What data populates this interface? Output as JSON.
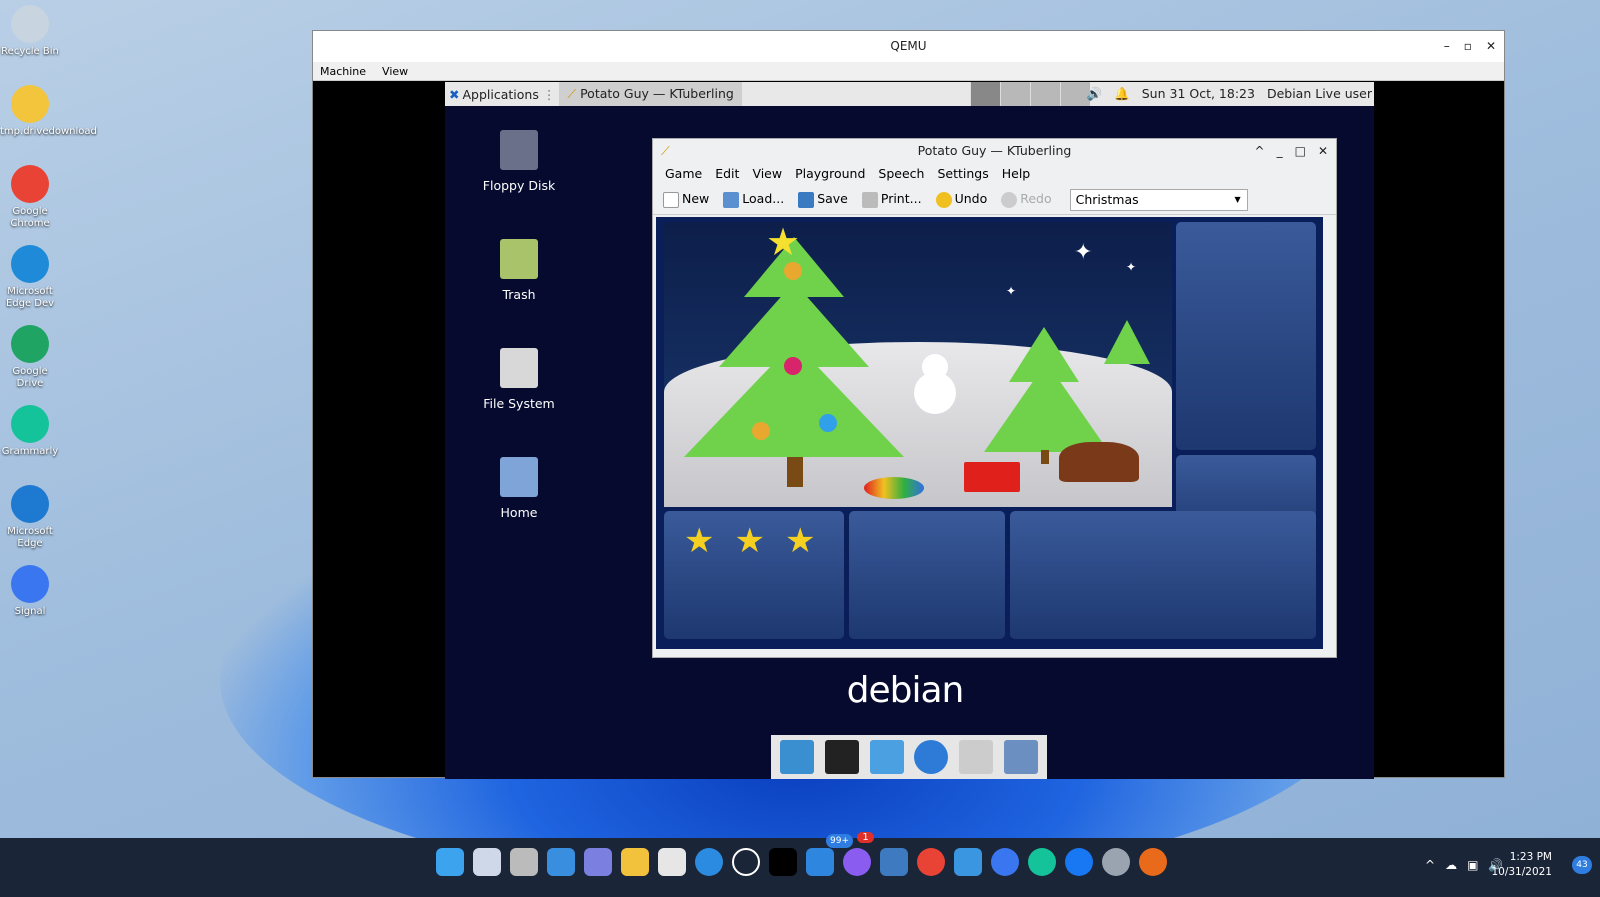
{
  "desktop": {
    "icons": [
      {
        "label": "Recycle Bin",
        "color": "#c8d4e0"
      },
      {
        "label": "tmp.drivedownload",
        "color": "#f2c53d"
      },
      {
        "label": "Google Chrome",
        "color": "#e84335"
      },
      {
        "label": "Microsoft Edge Dev",
        "color": "#1f8ad8"
      },
      {
        "label": "Google Drive",
        "color": "#1fa463"
      },
      {
        "label": "Grammarly",
        "color": "#15c39a"
      },
      {
        "label": "Microsoft Edge",
        "color": "#1e7ad0"
      },
      {
        "label": "Signal",
        "color": "#3a76f0"
      }
    ]
  },
  "qemu": {
    "title": "QEMU",
    "menu": [
      "Machine",
      "View"
    ],
    "controls": [
      "–",
      "▫",
      "✕"
    ]
  },
  "guest": {
    "panel": {
      "applications": "Applications",
      "task": "Potato Guy — KTuberling",
      "datetime": "Sun 31 Oct, 18:23",
      "user": "Debian Live user",
      "volume_icon": "🔊",
      "bell_icon": "🔔"
    },
    "icons": [
      {
        "label": "Floppy Disk",
        "color": "#6a6f8a"
      },
      {
        "label": "Trash",
        "color": "#a8c36a"
      },
      {
        "label": "File System",
        "color": "#d8d8d8"
      },
      {
        "label": "Home",
        "color": "#7fa4d8"
      }
    ],
    "logo": "debian",
    "dock": [
      {
        "name": "desktop",
        "color": "#3a8fd0"
      },
      {
        "name": "terminal",
        "color": "#222"
      },
      {
        "name": "files",
        "color": "#4aa0e0"
      },
      {
        "name": "browser",
        "color": "#2d7bd6"
      },
      {
        "name": "search",
        "color": "#ccc"
      },
      {
        "name": "folder",
        "color": "#6a8fc0"
      }
    ]
  },
  "ktuberling": {
    "title": "Potato Guy — KTuberling",
    "menu": [
      "Game",
      "Edit",
      "View",
      "Playground",
      "Speech",
      "Settings",
      "Help"
    ],
    "toolbar": {
      "new": "New",
      "load": "Load...",
      "save": "Save",
      "print": "Print...",
      "undo": "Undo",
      "redo": "Redo"
    },
    "playground": "Christmas"
  },
  "taskbar": {
    "icons": [
      {
        "name": "start",
        "color": "#3ca3ef"
      },
      {
        "name": "search",
        "color": "#cfd8e8"
      },
      {
        "name": "task-view",
        "color": "#bbbbbb"
      },
      {
        "name": "widgets",
        "color": "#3a8ee0"
      },
      {
        "name": "teams-chat",
        "color": "#7b7fe0"
      },
      {
        "name": "file-explorer",
        "color": "#f3c23d"
      },
      {
        "name": "store",
        "color": "#e6e6e6"
      },
      {
        "name": "edge-dev",
        "color": "#2a8be0"
      },
      {
        "name": "dell",
        "color": "#1b2538"
      },
      {
        "name": "terminal",
        "color": "#000000"
      },
      {
        "name": "mail",
        "color": "#2e86de"
      },
      {
        "name": "messenger",
        "color": "#8a5cf0"
      },
      {
        "name": "remote-desktop",
        "color": "#3d7ac0"
      },
      {
        "name": "chrome",
        "color": "#e84335"
      },
      {
        "name": "people",
        "color": "#3a96e0"
      },
      {
        "name": "signal",
        "color": "#3a76f0"
      },
      {
        "name": "grammarly",
        "color": "#15c39a"
      },
      {
        "name": "facebook",
        "color": "#1877f2"
      },
      {
        "name": "settings",
        "color": "#9aa4b0"
      },
      {
        "name": "qemu",
        "color": "#e86a1a"
      }
    ],
    "mail_badge": "99+",
    "messenger_badge": "1",
    "time": "1:23 PM",
    "date": "10/31/2021",
    "notifications": "43"
  }
}
